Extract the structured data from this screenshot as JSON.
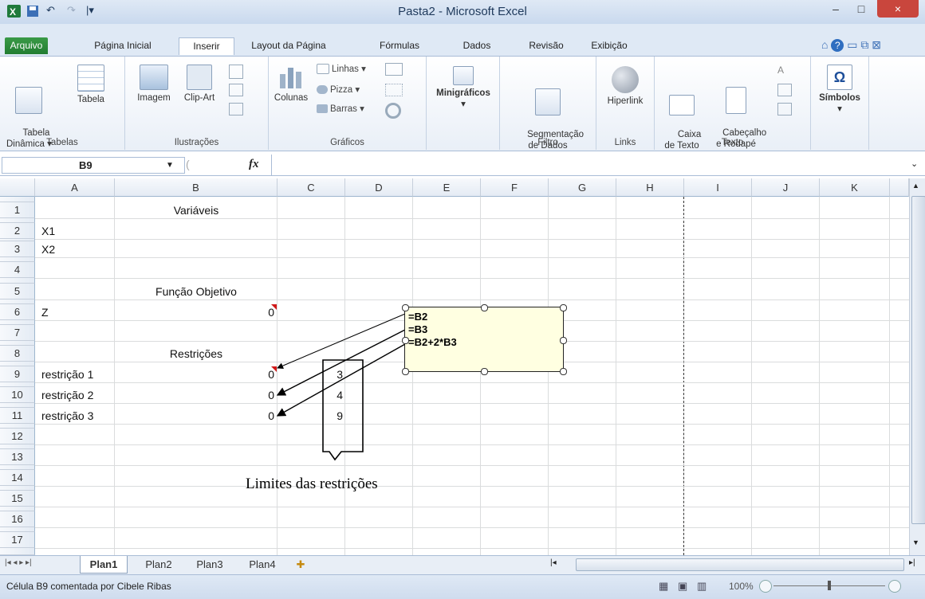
{
  "window": {
    "title": "Pasta2 - Microsoft Excel",
    "minimize": "–",
    "maximize": "□",
    "close": "×"
  },
  "qat": {
    "undo": "↶",
    "redo": "↷",
    "more": "|▾"
  },
  "tabs": [
    {
      "label": "Arquivo"
    },
    {
      "label": "Página Inicial"
    },
    {
      "label": "Inserir"
    },
    {
      "label": "Layout da Página"
    },
    {
      "label": "Fórmulas"
    },
    {
      "label": "Dados"
    },
    {
      "label": "Revisão"
    },
    {
      "label": "Exibição"
    }
  ],
  "ribbon": {
    "tabelas": {
      "group": "Tabelas",
      "pivot": "Tabela\nDinâmica ▾",
      "table": "Tabela"
    },
    "ilustracoes": {
      "group": "Ilustrações",
      "image": "Imagem",
      "clipart": "Clip-Art"
    },
    "graficos": {
      "group": "Gráficos",
      "columns": "Colunas",
      "lines": "Linhas ▾",
      "pie": "Pizza ▾",
      "bars": "Barras ▾"
    },
    "minigraficos": {
      "label": "Minigráficos"
    },
    "filtro": {
      "group": "Filtro",
      "slicer": "Segmentação\nde Dados"
    },
    "links": {
      "group": "Links",
      "hyperlink": "Hiperlink"
    },
    "texto": {
      "group": "Texto",
      "textbox": "Caixa\nde Texto",
      "header": "Cabeçalho\ne Rodapé"
    },
    "simbolos": {
      "label": "Símbolos",
      "glyph": "Ω"
    }
  },
  "formula_bar": {
    "name_box": "B9",
    "fx": "fx",
    "formula": ""
  },
  "columns": [
    "A",
    "B",
    "C",
    "D",
    "E",
    "F",
    "G",
    "H",
    "I",
    "J",
    "K"
  ],
  "rows": [
    "1",
    "2",
    "3",
    "4",
    "5",
    "6",
    "7",
    "8",
    "9",
    "10",
    "11",
    "12",
    "13",
    "14",
    "15",
    "16",
    "17"
  ],
  "cells": {
    "B1": "Variáveis",
    "A2": "X1",
    "A3": "X2",
    "B5": "Função Objetivo",
    "A6": "Z",
    "B6": "0",
    "B8": "Restrições",
    "A9": "restrição 1",
    "B9": "0",
    "C9": "3",
    "A10": "restrição 2",
    "B10": "0",
    "C10": "4",
    "A11": "restrição 3",
    "B11": "0",
    "C11": "9"
  },
  "comment": {
    "lines": [
      "=B2",
      "=B3",
      "=B2+2*B3"
    ]
  },
  "callout": {
    "text": "Limites das restrições"
  },
  "sheets": [
    {
      "label": "Plan1"
    },
    {
      "label": "Plan2"
    },
    {
      "label": "Plan3"
    },
    {
      "label": "Plan4"
    }
  ],
  "status": {
    "text": "Célula B9 comentada por Cibele Ribas",
    "zoom": "100%"
  }
}
